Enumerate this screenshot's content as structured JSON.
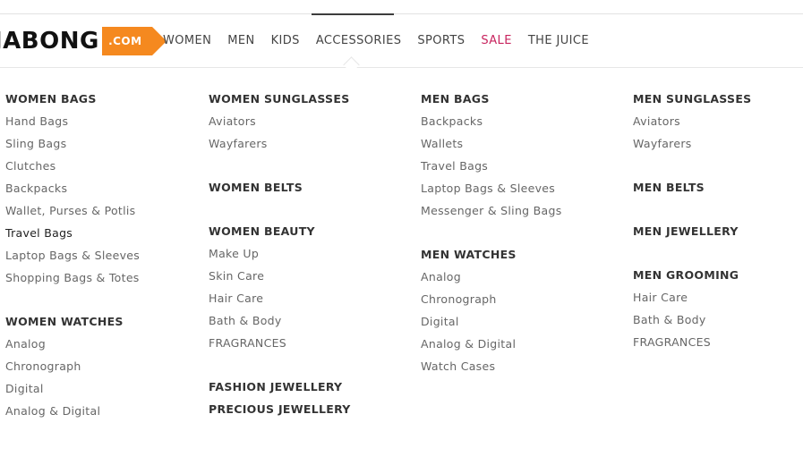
{
  "logo": {
    "text": "JABONG",
    "tag": ".COM"
  },
  "nav": {
    "items": [
      "WOMEN",
      "MEN",
      "KIDS",
      "ACCESSORIES",
      "SPORTS",
      "SALE",
      "THE JUICE"
    ],
    "active": "ACCESSORIES"
  },
  "colors": {
    "accent": "#f5891f",
    "sale": "#c8245e",
    "active_bar": "#3c3c3c"
  },
  "menu": {
    "col1": {
      "women_bags": {
        "title": "WOMEN BAGS",
        "items": [
          "Hand Bags",
          "Sling Bags",
          "Clutches",
          "Backpacks",
          "Wallet, Purses & Potlis",
          "Travel Bags",
          "Laptop Bags & Sleeves",
          "Shopping Bags & Totes"
        ]
      },
      "women_watches": {
        "title": "WOMEN WATCHES",
        "items": [
          "Analog",
          "Chronograph",
          "Digital",
          "Analog & Digital"
        ]
      }
    },
    "col2": {
      "women_sunglasses": {
        "title": "WOMEN SUNGLASSES",
        "items": [
          "Aviators",
          "Wayfarers"
        ]
      },
      "women_belts": {
        "title": "WOMEN BELTS"
      },
      "women_beauty": {
        "title": "WOMEN BEAUTY",
        "items": [
          "Make Up",
          "Skin Care",
          "Hair Care",
          "Bath & Body",
          "FRAGRANCES"
        ]
      },
      "fashion_jewellery": {
        "title": "FASHION JEWELLERY"
      },
      "precious_jewellery": {
        "title": "PRECIOUS JEWELLERY"
      }
    },
    "col3": {
      "men_bags": {
        "title": "MEN BAGS",
        "items": [
          "Backpacks",
          "Wallets",
          "Travel Bags",
          "Laptop Bags & Sleeves",
          "Messenger & Sling Bags"
        ]
      },
      "men_watches": {
        "title": "MEN WATCHES",
        "items": [
          "Analog",
          "Chronograph",
          "Digital",
          "Analog & Digital",
          "Watch Cases"
        ]
      }
    },
    "col4": {
      "men_sunglasses": {
        "title": "MEN SUNGLASSES",
        "items": [
          "Aviators",
          "Wayfarers"
        ]
      },
      "men_belts": {
        "title": "MEN BELTS"
      },
      "men_jewellery": {
        "title": "MEN JEWELLERY"
      },
      "men_grooming": {
        "title": "MEN GROOMING",
        "items": [
          "Hair Care",
          "Bath & Body",
          "FRAGRANCES"
        ]
      }
    }
  }
}
